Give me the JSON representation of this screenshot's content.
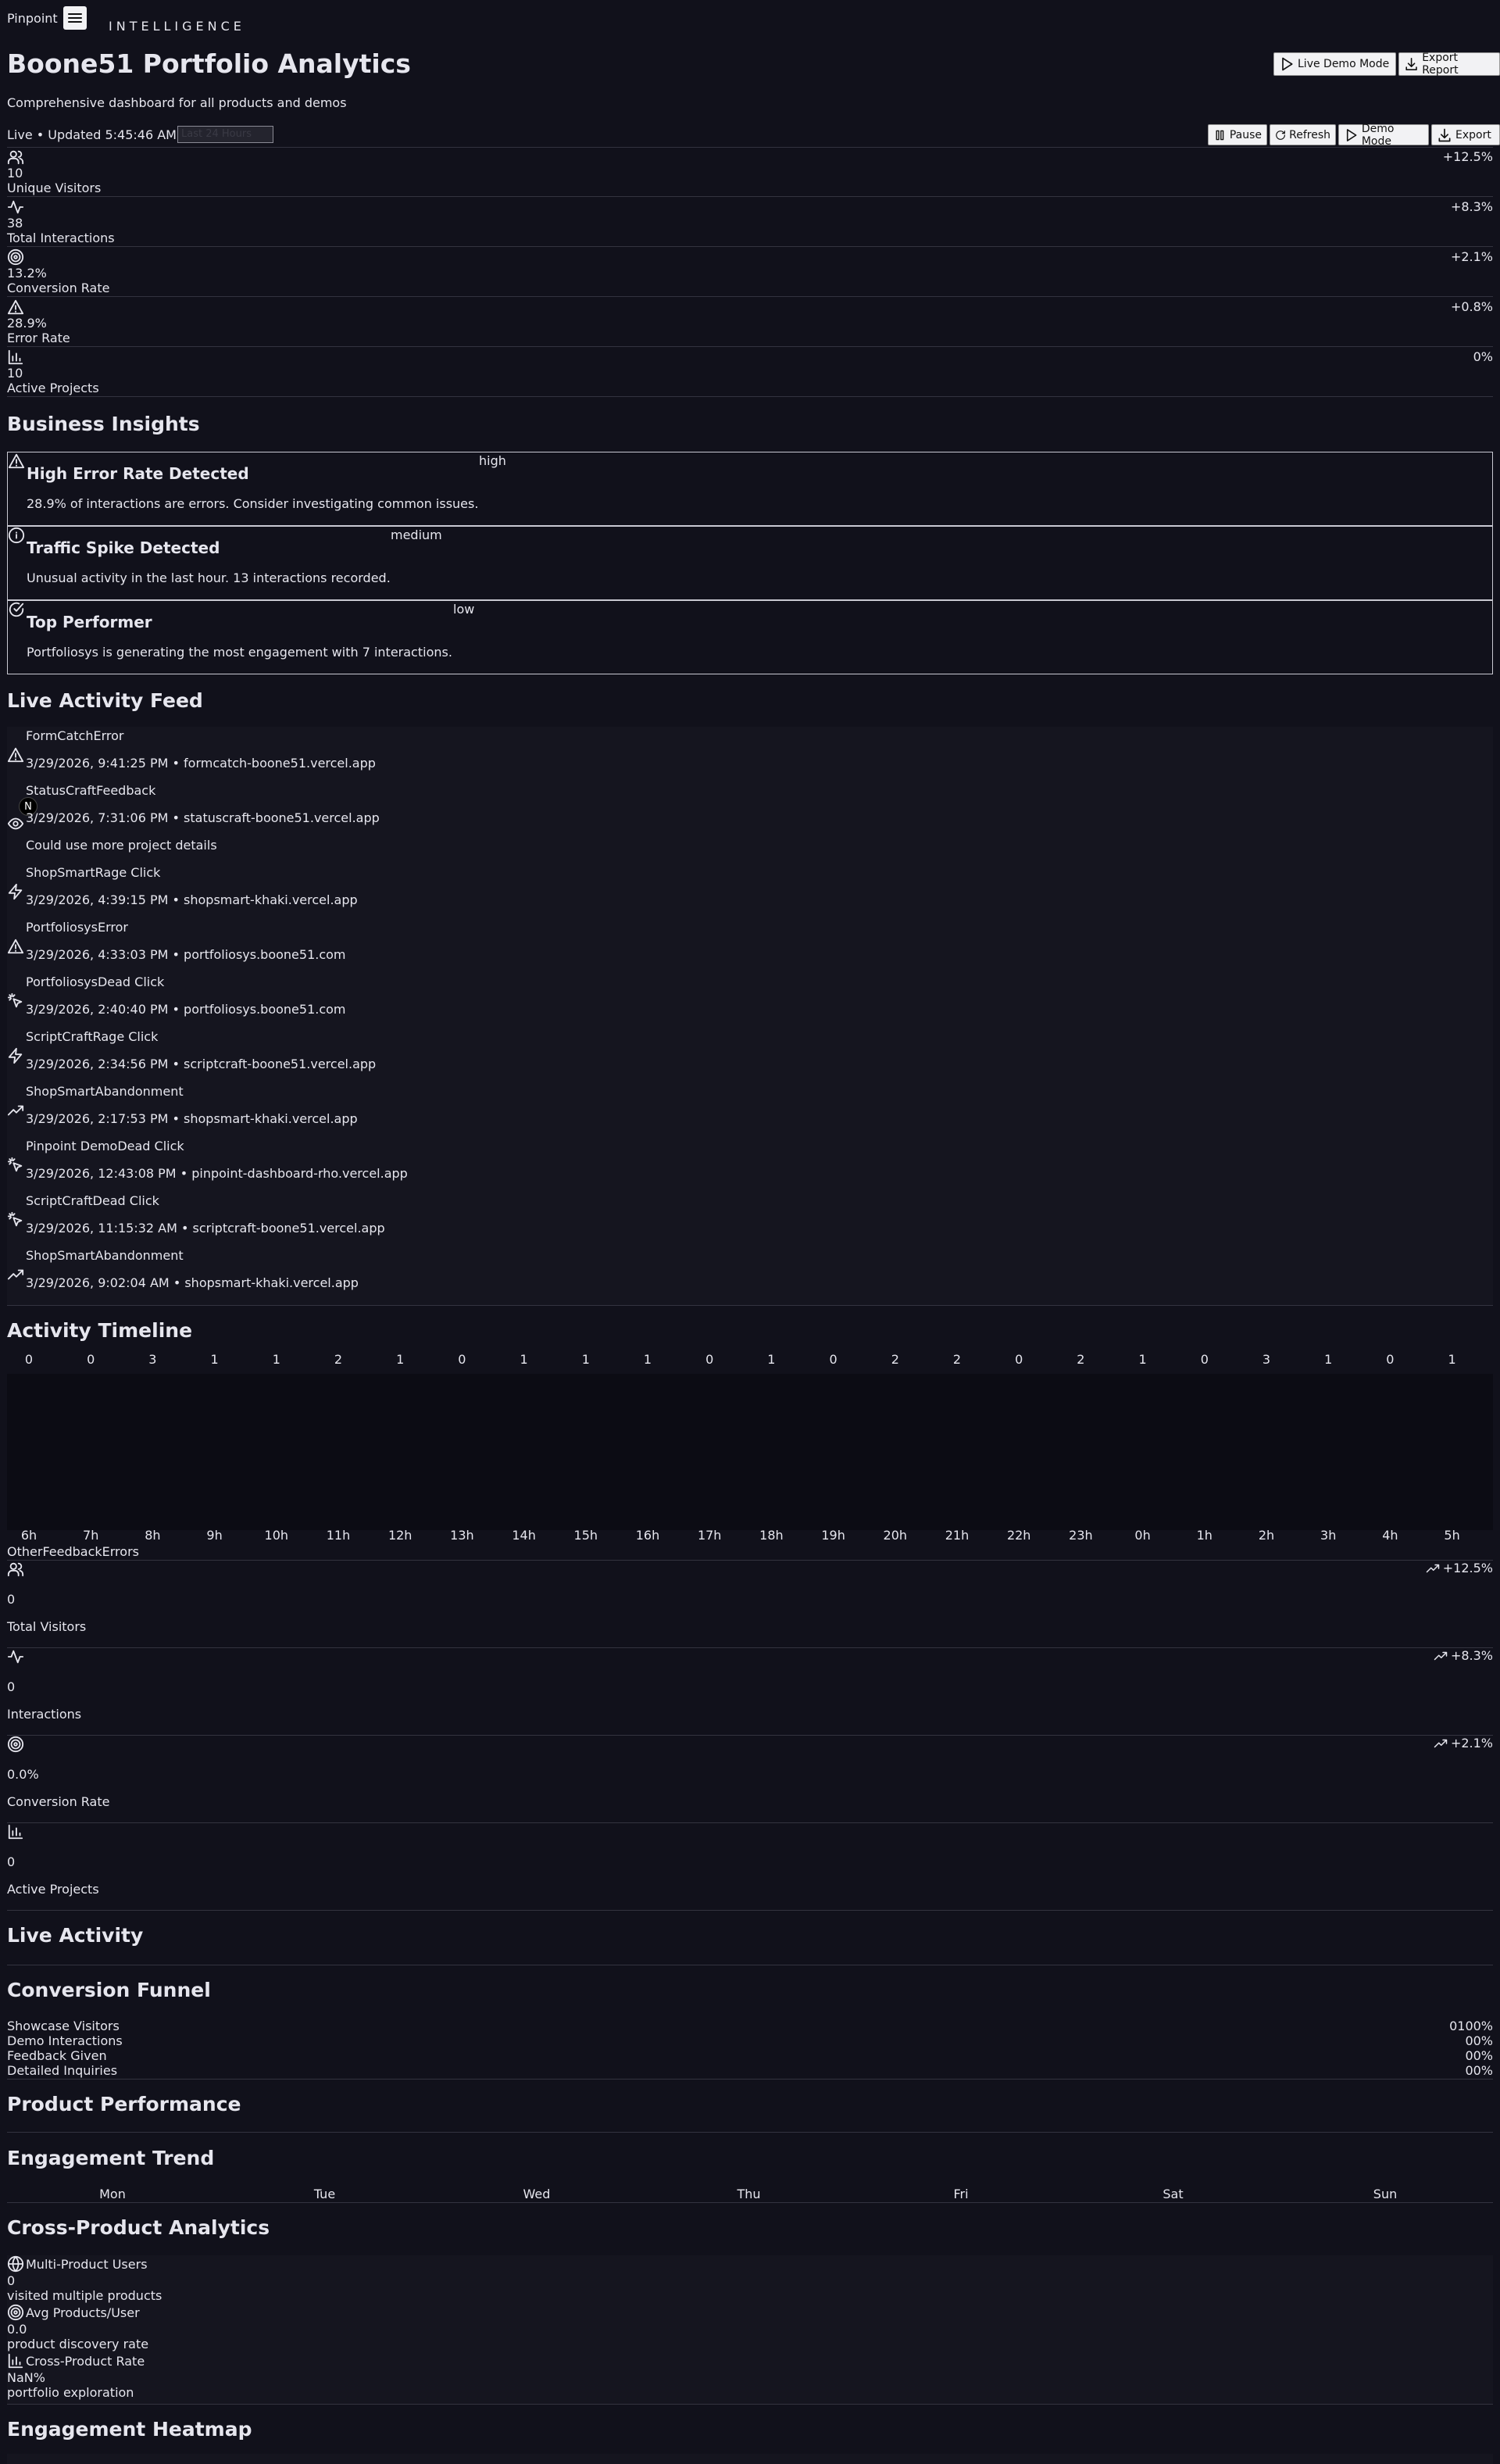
{
  "brand": {
    "name": "Pinpoint",
    "tagline": "INTELLIGENCE"
  },
  "header": {
    "title": "Boone51 Portfolio Analytics",
    "subtitle": "Comprehensive dashboard for all products and demos",
    "live_demo_label": "Live Demo Mode",
    "export_report_label": "Export Report"
  },
  "status": {
    "live_text": "Live • Updated 5:45:46 AM",
    "range_value": "Last 24 Hours",
    "pause_label": "Pause",
    "refresh_label": "Refresh",
    "demo_label": "Demo Mode",
    "export_label": "Export"
  },
  "metrics": [
    {
      "icon": "users-icon",
      "value": "10",
      "label": "Unique Visitors",
      "change": "+12.5%"
    },
    {
      "icon": "activity-icon",
      "value": "38",
      "label": "Total Interactions",
      "change": "+8.3%"
    },
    {
      "icon": "target-icon",
      "value": "13.2%",
      "label": "Conversion Rate",
      "change": "+2.1%"
    },
    {
      "icon": "warning-icon",
      "value": "28.9%",
      "label": "Error Rate",
      "change": "+0.8%"
    },
    {
      "icon": "bar-chart-icon",
      "value": "10",
      "label": "Active Projects",
      "change": "0%"
    }
  ],
  "insights": {
    "heading": "Business Insights",
    "items": [
      {
        "icon": "warning-icon",
        "severity": "high",
        "title": "High Error Rate Detected",
        "desc": "28.9% of interactions are errors. Consider investigating common issues."
      },
      {
        "icon": "info-icon",
        "severity": "medium",
        "title": "Traffic Spike Detected",
        "desc": "Unusual activity in the last hour. 13 interactions recorded."
      },
      {
        "icon": "check-circle-icon",
        "severity": "low",
        "title": "Top Performer",
        "desc": "Portfoliosys is generating the most engagement with 7 interactions."
      }
    ]
  },
  "feed": {
    "heading": "Live Activity Feed",
    "items": [
      {
        "icon": "warning-icon",
        "title": "FormCatchError",
        "meta": "3/29/2026, 9:41:25 PM • formcatch-boone51.vercel.app"
      },
      {
        "icon": "eye-icon",
        "title": "StatusCraftFeedback",
        "meta": "3/29/2026, 7:31:06 PM • statuscraft-boone51.vercel.app",
        "extra": "Could use more project details"
      },
      {
        "icon": "zap-icon",
        "title": "ShopSmartRage Click",
        "meta": "3/29/2026, 4:39:15 PM • shopsmart-khaki.vercel.app"
      },
      {
        "icon": "warning-icon",
        "title": "PortfoliosysError",
        "meta": "3/29/2026, 4:33:03 PM • portfoliosys.boone51.com"
      },
      {
        "icon": "pointer-icon",
        "title": "PortfoliosysDead Click",
        "meta": "3/29/2026, 2:40:40 PM • portfoliosys.boone51.com"
      },
      {
        "icon": "zap-icon",
        "title": "ScriptCraftRage Click",
        "meta": "3/29/2026, 2:34:56 PM • scriptcraft-boone51.vercel.app"
      },
      {
        "icon": "trending-up-icon",
        "title": "ShopSmartAbandonment",
        "meta": "3/29/2026, 2:17:53 PM • shopsmart-khaki.vercel.app"
      },
      {
        "icon": "pointer-icon",
        "title": "Pinpoint DemoDead Click",
        "meta": "3/29/2026, 12:43:08 PM • pinpoint-dashboard-rho.vercel.app"
      },
      {
        "icon": "pointer-icon",
        "title": "ScriptCraftDead Click",
        "meta": "3/29/2026, 11:15:32 AM • scriptcraft-boone51.vercel.app"
      },
      {
        "icon": "trending-up-icon",
        "title": "ShopSmartAbandonment",
        "meta": "3/29/2026, 9:02:04 AM • shopsmart-khaki.vercel.app"
      }
    ]
  },
  "avatar_letter": "N",
  "timeline": {
    "heading": "Activity Timeline",
    "legend": [
      "Other",
      "Feedback",
      "Errors"
    ],
    "hours": [
      "6h",
      "7h",
      "8h",
      "9h",
      "10h",
      "11h",
      "12h",
      "13h",
      "14h",
      "15h",
      "16h",
      "17h",
      "18h",
      "19h",
      "20h",
      "21h",
      "22h",
      "23h",
      "0h",
      "1h",
      "2h",
      "3h",
      "4h",
      "5h"
    ],
    "counts": [
      0,
      0,
      3,
      1,
      1,
      2,
      1,
      0,
      1,
      1,
      1,
      0,
      1,
      0,
      2,
      2,
      0,
      2,
      1,
      0,
      3,
      1,
      0,
      1
    ]
  },
  "kpis": [
    {
      "icon": "users-icon",
      "value": "0",
      "label": "Total Visitors",
      "change": "+12.5%"
    },
    {
      "icon": "activity-icon",
      "value": "0",
      "label": "Interactions",
      "change": "+8.3%"
    },
    {
      "icon": "target-icon",
      "value": "0.0%",
      "label": "Conversion Rate",
      "change": "+2.1%"
    },
    {
      "icon": "bar-chart-icon",
      "value": "0",
      "label": "Active Projects",
      "change": ""
    }
  ],
  "live_activity": {
    "heading": "Live Activity"
  },
  "funnel": {
    "heading": "Conversion Funnel",
    "steps": [
      {
        "label": "Showcase Visitors",
        "value": "0100%"
      },
      {
        "label": "Demo Interactions",
        "value": "00%"
      },
      {
        "label": "Feedback Given",
        "value": "00%"
      },
      {
        "label": "Detailed Inquiries",
        "value": "00%"
      }
    ]
  },
  "product_performance": {
    "heading": "Product Performance"
  },
  "engagement_trend": {
    "heading": "Engagement Trend",
    "days": [
      "Mon",
      "Tue",
      "Wed",
      "Thu",
      "Fri",
      "Sat",
      "Sun"
    ]
  },
  "cross_product": {
    "heading": "Cross-Product Analytics",
    "items": [
      {
        "icon": "globe-icon",
        "label": "Multi-Product Users",
        "value": "0",
        "desc": "visited multiple products"
      },
      {
        "icon": "target-icon",
        "label": "Avg Products/User",
        "value": "0.0",
        "desc": "product discovery rate"
      },
      {
        "icon": "bar-chart-icon",
        "label": "Cross-Product Rate",
        "value": "NaN%",
        "desc": "portfolio exploration"
      }
    ]
  },
  "heatmap": {
    "heading": "Engagement Heatmap"
  }
}
